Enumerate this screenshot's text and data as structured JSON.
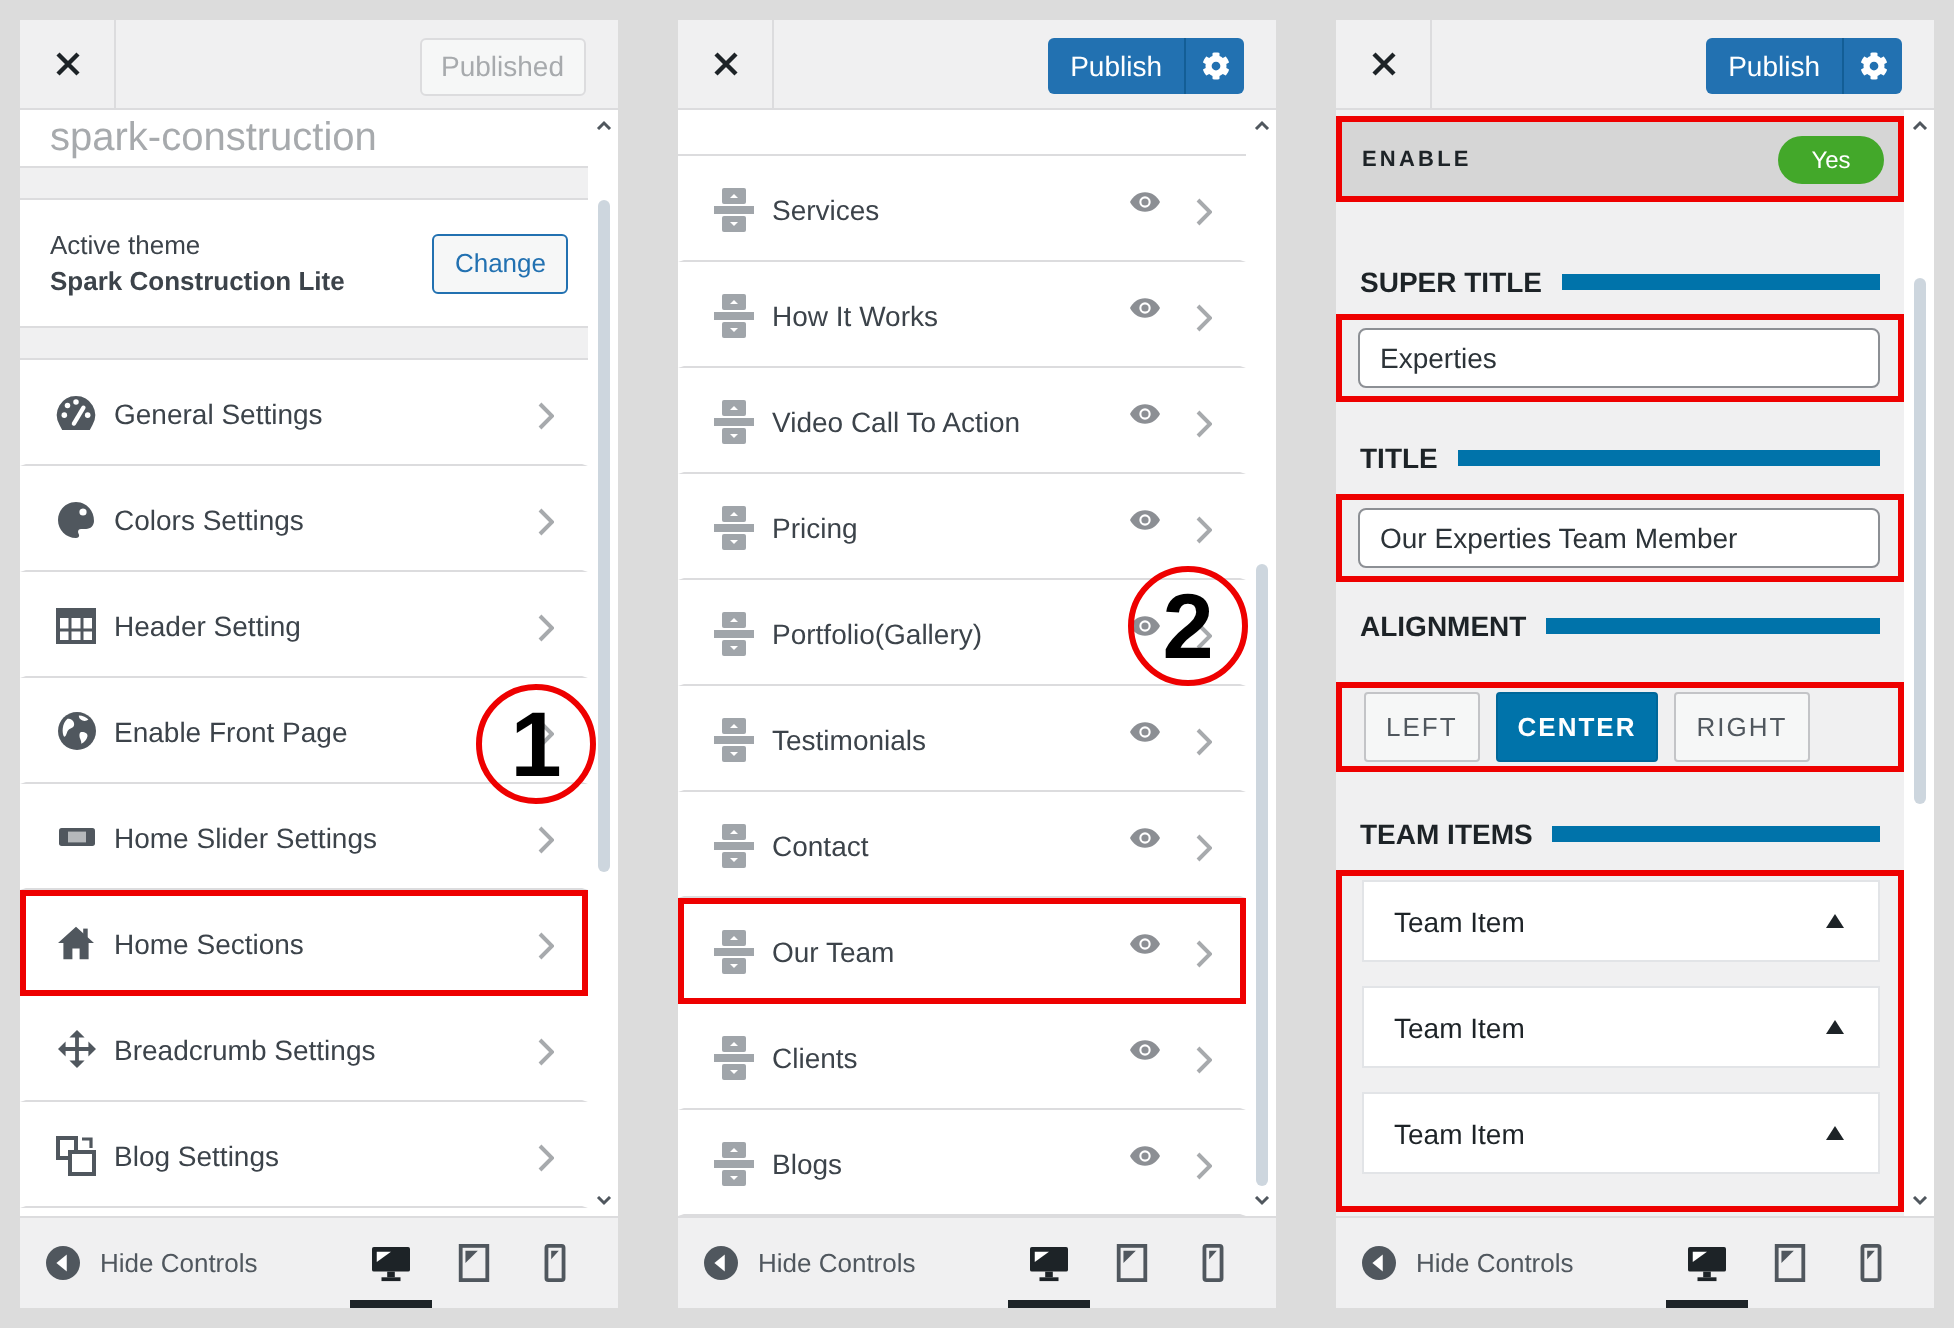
{
  "panels": [
    {
      "kind": "menu",
      "publish": {
        "label": "Published",
        "disabled": true
      },
      "site_name": "spark-construction",
      "theme": {
        "caption": "Active theme",
        "name": "Spark Construction Lite",
        "button": "Change"
      },
      "items": [
        {
          "label": "General Settings",
          "highlighted": false
        },
        {
          "label": "Colors Settings",
          "highlighted": false
        },
        {
          "label": "Header Setting",
          "highlighted": false
        },
        {
          "label": "Enable Front Page",
          "highlighted": false
        },
        {
          "label": "Home Slider Settings",
          "highlighted": false
        },
        {
          "label": "Home Sections",
          "highlighted": true
        },
        {
          "label": "Breadcrumb Settings",
          "highlighted": false
        },
        {
          "label": "Blog Settings",
          "highlighted": false
        }
      ],
      "marker": "1",
      "footer": {
        "label": "Hide Controls",
        "devices": [
          {
            "kind": "desktop",
            "selected": true
          },
          {
            "kind": "tablet",
            "selected": false
          },
          {
            "kind": "mobile",
            "selected": false
          }
        ]
      }
    },
    {
      "kind": "sections",
      "publish": {
        "label": "Publish",
        "disabled": false
      },
      "items": [
        {
          "label": "Services",
          "highlighted": false
        },
        {
          "label": "How It Works",
          "highlighted": false
        },
        {
          "label": "Video Call To Action",
          "highlighted": false
        },
        {
          "label": "Pricing",
          "highlighted": false
        },
        {
          "label": "Portfolio(Gallery)",
          "highlighted": false
        },
        {
          "label": "Testimonials",
          "highlighted": false
        },
        {
          "label": "Contact",
          "highlighted": false
        },
        {
          "label": "Our Team",
          "highlighted": true
        },
        {
          "label": "Clients",
          "highlighted": false
        },
        {
          "label": "Blogs",
          "highlighted": false
        }
      ],
      "marker": "2",
      "footer": {
        "label": "Hide Controls",
        "devices": [
          {
            "kind": "desktop",
            "selected": true
          },
          {
            "kind": "tablet",
            "selected": false
          },
          {
            "kind": "mobile",
            "selected": false
          }
        ]
      }
    },
    {
      "kind": "form",
      "publish": {
        "label": "Publish",
        "disabled": false
      },
      "enable": {
        "label": "ENABLE",
        "value": "Yes",
        "on": true,
        "highlighted": true
      },
      "fields": [
        {
          "heading": "SUPER TITLE",
          "value": "Experties",
          "highlighted": true
        },
        {
          "heading": "TITLE",
          "value": "Our Experties Team Member",
          "highlighted": true
        }
      ],
      "alignment": {
        "heading": "ALIGNMENT",
        "highlighted": true,
        "options": [
          {
            "label": "LEFT",
            "selected": false
          },
          {
            "label": "CENTER",
            "selected": true
          },
          {
            "label": "RIGHT",
            "selected": false
          }
        ]
      },
      "team": {
        "heading": "TEAM ITEMS",
        "highlighted": true,
        "items": [
          {
            "label": "Team Item"
          },
          {
            "label": "Team Item"
          },
          {
            "label": "Team Item"
          }
        ]
      },
      "footer": {
        "label": "Hide Controls",
        "devices": [
          {
            "kind": "desktop",
            "selected": true
          },
          {
            "kind": "tablet",
            "selected": false
          },
          {
            "kind": "mobile",
            "selected": false
          }
        ]
      }
    }
  ]
}
